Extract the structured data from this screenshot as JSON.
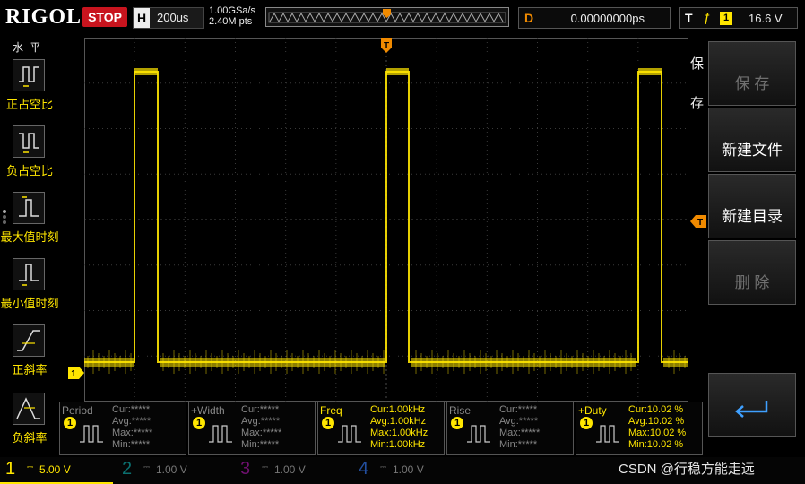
{
  "brand": "RIGOL",
  "status": "STOP",
  "horizontal": {
    "label": "H",
    "timebase": "200us"
  },
  "sampling": {
    "rate": "1.00GSa/s",
    "points": "2.40M pts"
  },
  "delay": {
    "label": "D",
    "value": "0.00000000ps"
  },
  "trigger": {
    "label": "T",
    "channel": "1",
    "level": "16.6 V"
  },
  "left_menu": {
    "title": "水 平",
    "items": [
      {
        "label": "正占空比",
        "icon": "positive-duty-icon"
      },
      {
        "label": "负占空比",
        "icon": "negative-duty-icon"
      },
      {
        "label": "最大值时刻",
        "icon": "max-time-icon"
      },
      {
        "label": "最小值时刻",
        "icon": "min-time-icon"
      },
      {
        "label": "正斜率",
        "icon": "positive-slope-icon"
      },
      {
        "label": "负斜率",
        "icon": "negative-slope-icon"
      }
    ]
  },
  "right_menu": {
    "title_1": "保",
    "title_2": "存",
    "buttons": [
      {
        "label": "保 存",
        "enabled": false
      },
      {
        "label": "新建文件",
        "enabled": true
      },
      {
        "label": "新建目录",
        "enabled": true
      },
      {
        "label": "删 除",
        "enabled": false
      }
    ],
    "back_icon": "return-arrow-icon"
  },
  "markers": {
    "trigger_pos": "T",
    "channel": "1",
    "trigger_level": "T"
  },
  "measurements": [
    {
      "name": "Period",
      "ch": "1",
      "cur": "Cur:*****",
      "avg": "Avg:*****",
      "max": "Max:*****",
      "min": "Min:*****",
      "active": false
    },
    {
      "name": "+Width",
      "ch": "1",
      "cur": "Cur:*****",
      "avg": "Avg:*****",
      "max": "Max:*****",
      "min": "Min:*****",
      "active": false
    },
    {
      "name": "Freq",
      "ch": "1",
      "cur": "Cur:1.00kHz",
      "avg": "Avg:1.00kHz",
      "max": "Max:1.00kHz",
      "min": "Min:1.00kHz",
      "active": true
    },
    {
      "name": "Rise",
      "ch": "1",
      "cur": "Cur:*****",
      "avg": "Avg:*****",
      "max": "Max:*****",
      "min": "Min:*****",
      "active": false
    },
    {
      "name": "+Duty",
      "ch": "1",
      "cur": "Cur:10.02 %",
      "avg": "Avg:10.02 %",
      "max": "Max:10.02 %",
      "min": "Min:10.02 %",
      "active": true
    }
  ],
  "channels": [
    {
      "num": "1",
      "scale": "5.00 V",
      "color": "#ffe600",
      "active": true
    },
    {
      "num": "2",
      "scale": "1.00 V",
      "color": "#00c8c8",
      "active": false
    },
    {
      "num": "3",
      "scale": "1.00 V",
      "color": "#d000d0",
      "active": false
    },
    {
      "num": "4",
      "scale": "1.00 V",
      "color": "#2f6fff",
      "active": false
    }
  ],
  "watermark": "CSDN @行稳方能走远",
  "colors": {
    "trace": "#ffe600",
    "trigger": "#f08a00",
    "stop": "#c8141e",
    "grid": "#3a3a3a"
  }
}
